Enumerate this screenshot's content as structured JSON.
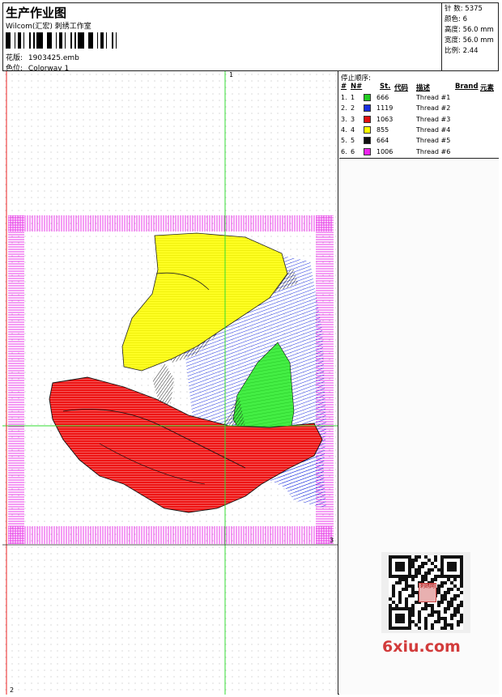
{
  "header": {
    "title": "生产作业图",
    "subtitle": "Wilcom(汇宏) 刺绣工作室",
    "design_label": "花版:",
    "design_file": "1903425.emb",
    "colorway_label": "色位:",
    "colorway": "Colorway 1"
  },
  "stats": [
    {
      "label": "针 数:",
      "value": "5375"
    },
    {
      "label": "颜色:",
      "value": "6"
    },
    {
      "label": "高度:",
      "value": "56.0 mm"
    },
    {
      "label": "宽度:",
      "value": "56.0 mm"
    },
    {
      "label": "比例:",
      "value": "2.44"
    }
  ],
  "canvas": {
    "label_top": "1",
    "label_bottom": "2",
    "label_right": "3"
  },
  "thread_table": {
    "title": "停止顺序:",
    "headers": {
      "num": "#",
      "n": "N#",
      "st": "St.",
      "code": "代码",
      "desc": "描述",
      "brand": "Brand",
      "element": "元素"
    },
    "rows": [
      {
        "num": "1.",
        "n": "1",
        "color": "#22cc22",
        "code": "666",
        "desc": "Thread #1"
      },
      {
        "num": "2.",
        "n": "2",
        "color": "#1a2ee0",
        "code": "1119",
        "desc": "Thread #2"
      },
      {
        "num": "3.",
        "n": "3",
        "color": "#e01010",
        "code": "1063",
        "desc": "Thread #3"
      },
      {
        "num": "4.",
        "n": "4",
        "color": "#ffff00",
        "code": "855",
        "desc": "Thread #4"
      },
      {
        "num": "5.",
        "n": "5",
        "color": "#111111",
        "code": "664",
        "desc": "Thread #5"
      },
      {
        "num": "6.",
        "n": "6",
        "color": "#ee22ee",
        "code": "1006",
        "desc": "Thread #6"
      }
    ]
  },
  "watermark": "6xiu.com",
  "qr_badge": "刺绣网",
  "icons": {
    "qr": "qr-code-icon",
    "barcode": "barcode-icon"
  }
}
